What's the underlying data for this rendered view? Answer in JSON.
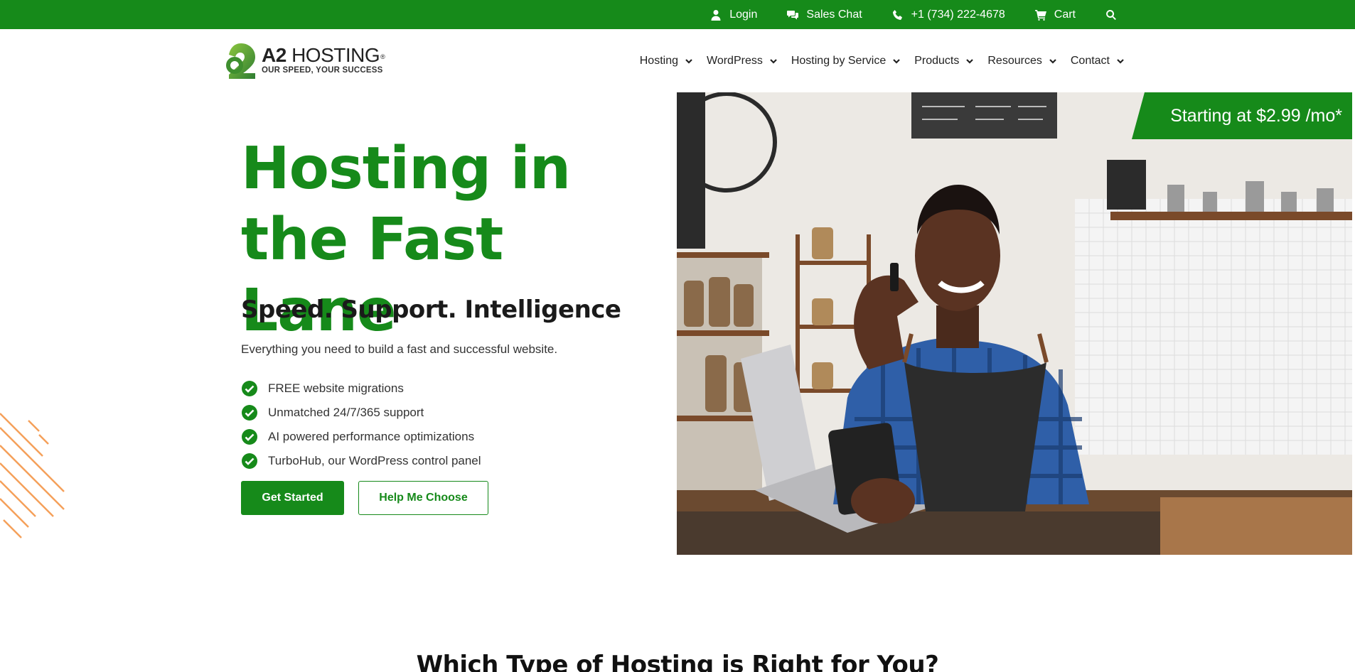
{
  "topbar": {
    "login": "Login",
    "sales_chat": "Sales Chat",
    "phone": "+1 (734) 222-4678",
    "cart": "Cart"
  },
  "logo": {
    "name_bold": "A2",
    "name_rest": " HOSTING",
    "registered": "®",
    "tagline": "OUR SPEED, YOUR SUCCESS"
  },
  "nav": {
    "items": [
      {
        "label": "Hosting"
      },
      {
        "label": "WordPress"
      },
      {
        "label": "Hosting by Service"
      },
      {
        "label": "Products"
      },
      {
        "label": "Resources"
      },
      {
        "label": "Contact"
      }
    ]
  },
  "hero": {
    "title_line1": "Hosting in",
    "title_line2": "the Fast Lane",
    "subtitle": "Speed. Support. Intelligence",
    "description": "Everything you need to build a fast and successful website.",
    "features": [
      "FREE website migrations",
      "Unmatched 24/7/365 support",
      "AI powered performance optimizations",
      "TurboHub, our WordPress control panel"
    ],
    "primary_button": "Get Started",
    "secondary_button": "Help Me Choose",
    "price_badge": "Starting at $2.99 /mo*"
  },
  "section": {
    "heading": "Which Type of Hosting is Right for You?"
  },
  "colors": {
    "brand_green": "#168a1a",
    "accent_orange": "#f5a05a"
  }
}
